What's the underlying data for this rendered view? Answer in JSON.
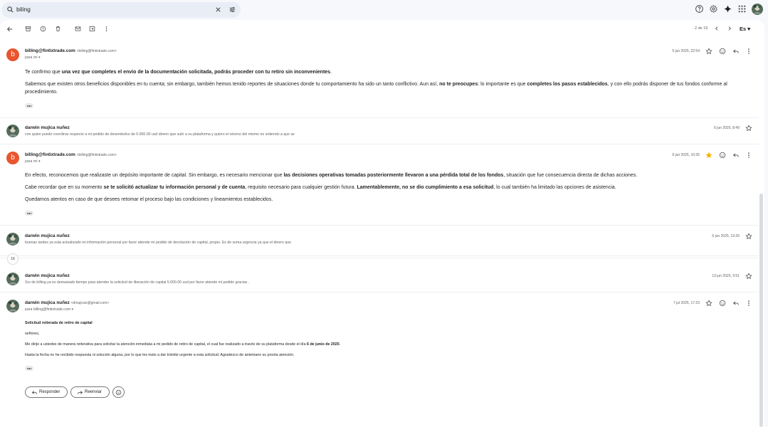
{
  "search": {
    "query": "biling"
  },
  "toolbar": {
    "pager": "2 de 19",
    "lang": "Es"
  },
  "collapsed_count": "16",
  "colors": {
    "accent": "#0b57d0",
    "billing_avatar": "#e8552e",
    "star": "#f4b400"
  },
  "messages": [
    {
      "sender": "billing@fintixtrade.com",
      "sender_email": "<billing@fintixtrade.com>",
      "to": "para mí",
      "date": "5 jun 2025, 22:54",
      "avatar_letter": "b",
      "paragraphs": [
        [
          {
            "t": "Te confirmo que "
          },
          {
            "t": "una vez que completes el envío de la documentación solicitada, podrás proceder con tu retiro sin inconvenientes",
            "b": true
          },
          {
            "t": "."
          }
        ],
        [
          {
            "t": "Sabemos que existen otros beneficios disponibles en tu cuenta; sin embargo, también hemos tenido reportes de situaciones donde tu comportamiento ha sido un tanto conflictivo. Aun así, "
          },
          {
            "t": "no te preocupes",
            "b": true
          },
          {
            "t": ": lo importante es que "
          },
          {
            "t": "completes los pasos establecidos",
            "b": true
          },
          {
            "t": ", y con ello podrás disponer de tus fondos conforme al procedimiento."
          }
        ]
      ]
    },
    {
      "sender": "darwin mujica nuñez",
      "snippet": "con quien puedo coordinar respecto a mi pedido de desembolso de 5.000.00 usd dinero que subí a su plataforma y quiero el retorno del mismo no entiendo a que se",
      "date": "6 jun 2025, 8:49"
    },
    {
      "sender": "billing@fintixtrade.com",
      "sender_email": "<billing@fintixtrade.com>",
      "to": "para mí",
      "date": "6 jun 2025, 10:35",
      "avatar_letter": "b",
      "starred": true,
      "paragraphs": [
        [
          {
            "t": "En efecto, reconocemos que realizaste un depósito importante de capital. Sin embargo, es necesario mencionar que "
          },
          {
            "t": "las decisiones operativas tomadas posteriormente llevaron a una pérdida total de los fondos",
            "b": true
          },
          {
            "t": ", situación que fue consecuencia directa de dichas acciones."
          }
        ],
        [
          {
            "t": "Cabe recordar que en su momento "
          },
          {
            "t": "se te solicitó actualizar tu información personal y de cuenta",
            "b": true
          },
          {
            "t": ", requisito necesario para cualquier gestión futura. "
          },
          {
            "t": "Lamentablemente, no se dio cumplimiento a esa solicitud",
            "b": true
          },
          {
            "t": ", lo cual también ha limitado las opciones de asistencia."
          }
        ],
        [
          {
            "t": "Quedamos atentos en caso de que desees retomar el proceso bajo las condiciones y lineamientos establecidos."
          }
        ]
      ]
    },
    {
      "sender": "darwin mujica nuñez",
      "snippet": "buenas tardes ya esta actualizado mi información personal por favor atiende mi pedido de devolución de capital, propio. Es de suma urgencia ya que el dinero que",
      "date": "6 jun 2025, 13:26"
    },
    {
      "sender": "darwin mujica nuñez",
      "snippet": "Srs de billing ya es demasiado tiempo para atender la solicitud de liberación de capital 5.000.00 usd por favor atiende mi pedido gracias .",
      "date": "13 jun 2025, 9:51"
    },
    {
      "sender": "darwin mujica nuñez",
      "sender_email": "<dmujican@gmail.com>",
      "to": "para billing@fintixtrade.com",
      "date": "7 jul 2025, 17:23",
      "paragraphs": [
        [
          {
            "t": "Solicitud reiterada de retiro de capital",
            "b": true
          }
        ],
        [
          {
            "t": " señores,"
          }
        ],
        [
          {
            "t": "Me dirijo a ustedes de manera reiterativa para solicitar la atención inmediata a mi pedido de retiro de capital, el cual fue realizado a través de su plataforma desde el día "
          },
          {
            "t": "6 de junio de 2025",
            "b": true
          },
          {
            "t": "."
          }
        ],
        [
          {
            "t": "Hasta la fecha no he recibido respuesta ni solución alguna, por lo que les insto a dar trámite urgente a esta solicitud. Agradezco de antemano su pronta atención."
          }
        ]
      ]
    }
  ],
  "actions": {
    "reply": "Responder",
    "forward": "Reenviar"
  }
}
